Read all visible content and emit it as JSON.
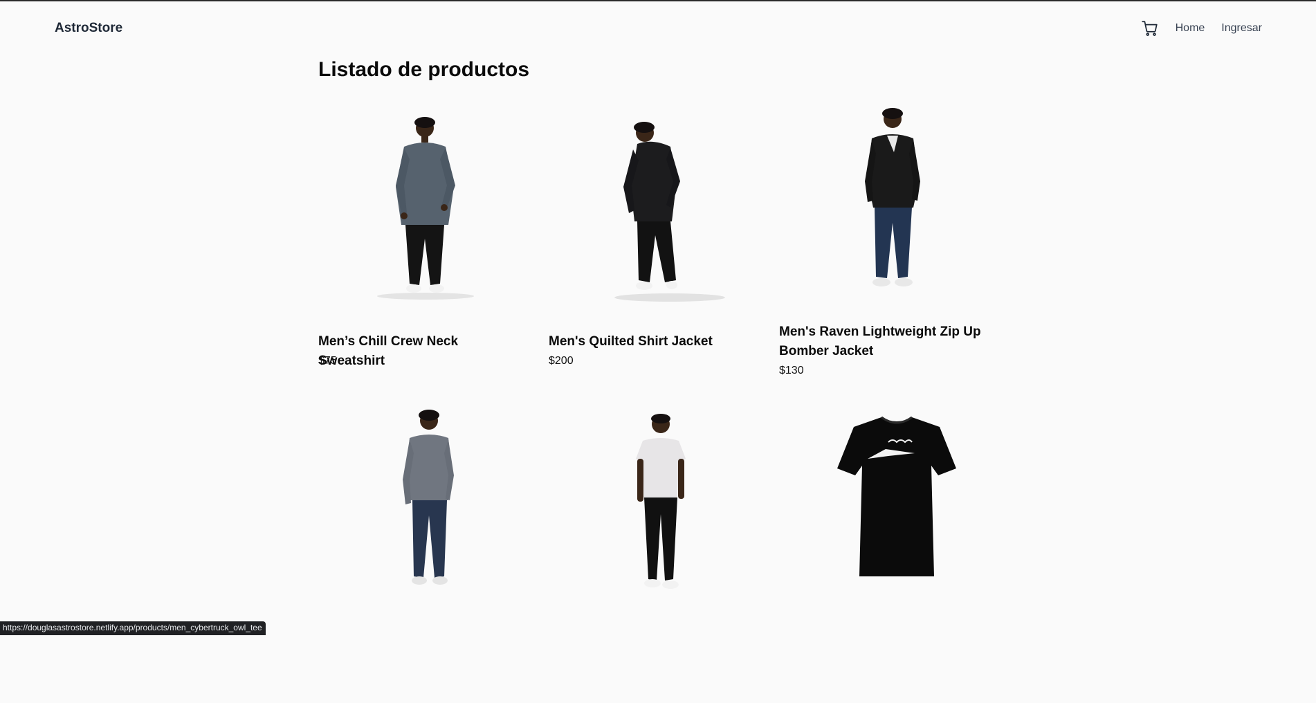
{
  "header": {
    "brand": "AstroStore",
    "nav": {
      "cart_icon": "cart-icon",
      "home_label": "Home",
      "login_label": "Ingresar"
    }
  },
  "main": {
    "title": "Listado de productos",
    "products": [
      {
        "name": "Men’s Chill Crew Neck Sweatshirt",
        "price": "$75",
        "image": "model-gray-sweatshirt"
      },
      {
        "name": "Men's Quilted Shirt Jacket",
        "price": "$200",
        "image": "model-black-quilted-jacket"
      },
      {
        "name": "Men's Raven Lightweight Zip Up Bomber Jacket",
        "price": "$130",
        "image": "model-black-bomber-jacket"
      },
      {
        "name": "",
        "price": "",
        "image": "model-gray-longsleeve"
      },
      {
        "name": "",
        "price": "",
        "image": "model-white-tee"
      },
      {
        "name": "",
        "price": "",
        "image": "black-cybertruck-tee"
      }
    ]
  },
  "status_bar": {
    "url": "https://douglasastrostore.netlify.app/products/men_cybertruck_owl_tee"
  },
  "colors": {
    "background": "#fafafa",
    "text": "#0a0a0a",
    "nav_text": "#374151",
    "status_bg": "#202124"
  }
}
